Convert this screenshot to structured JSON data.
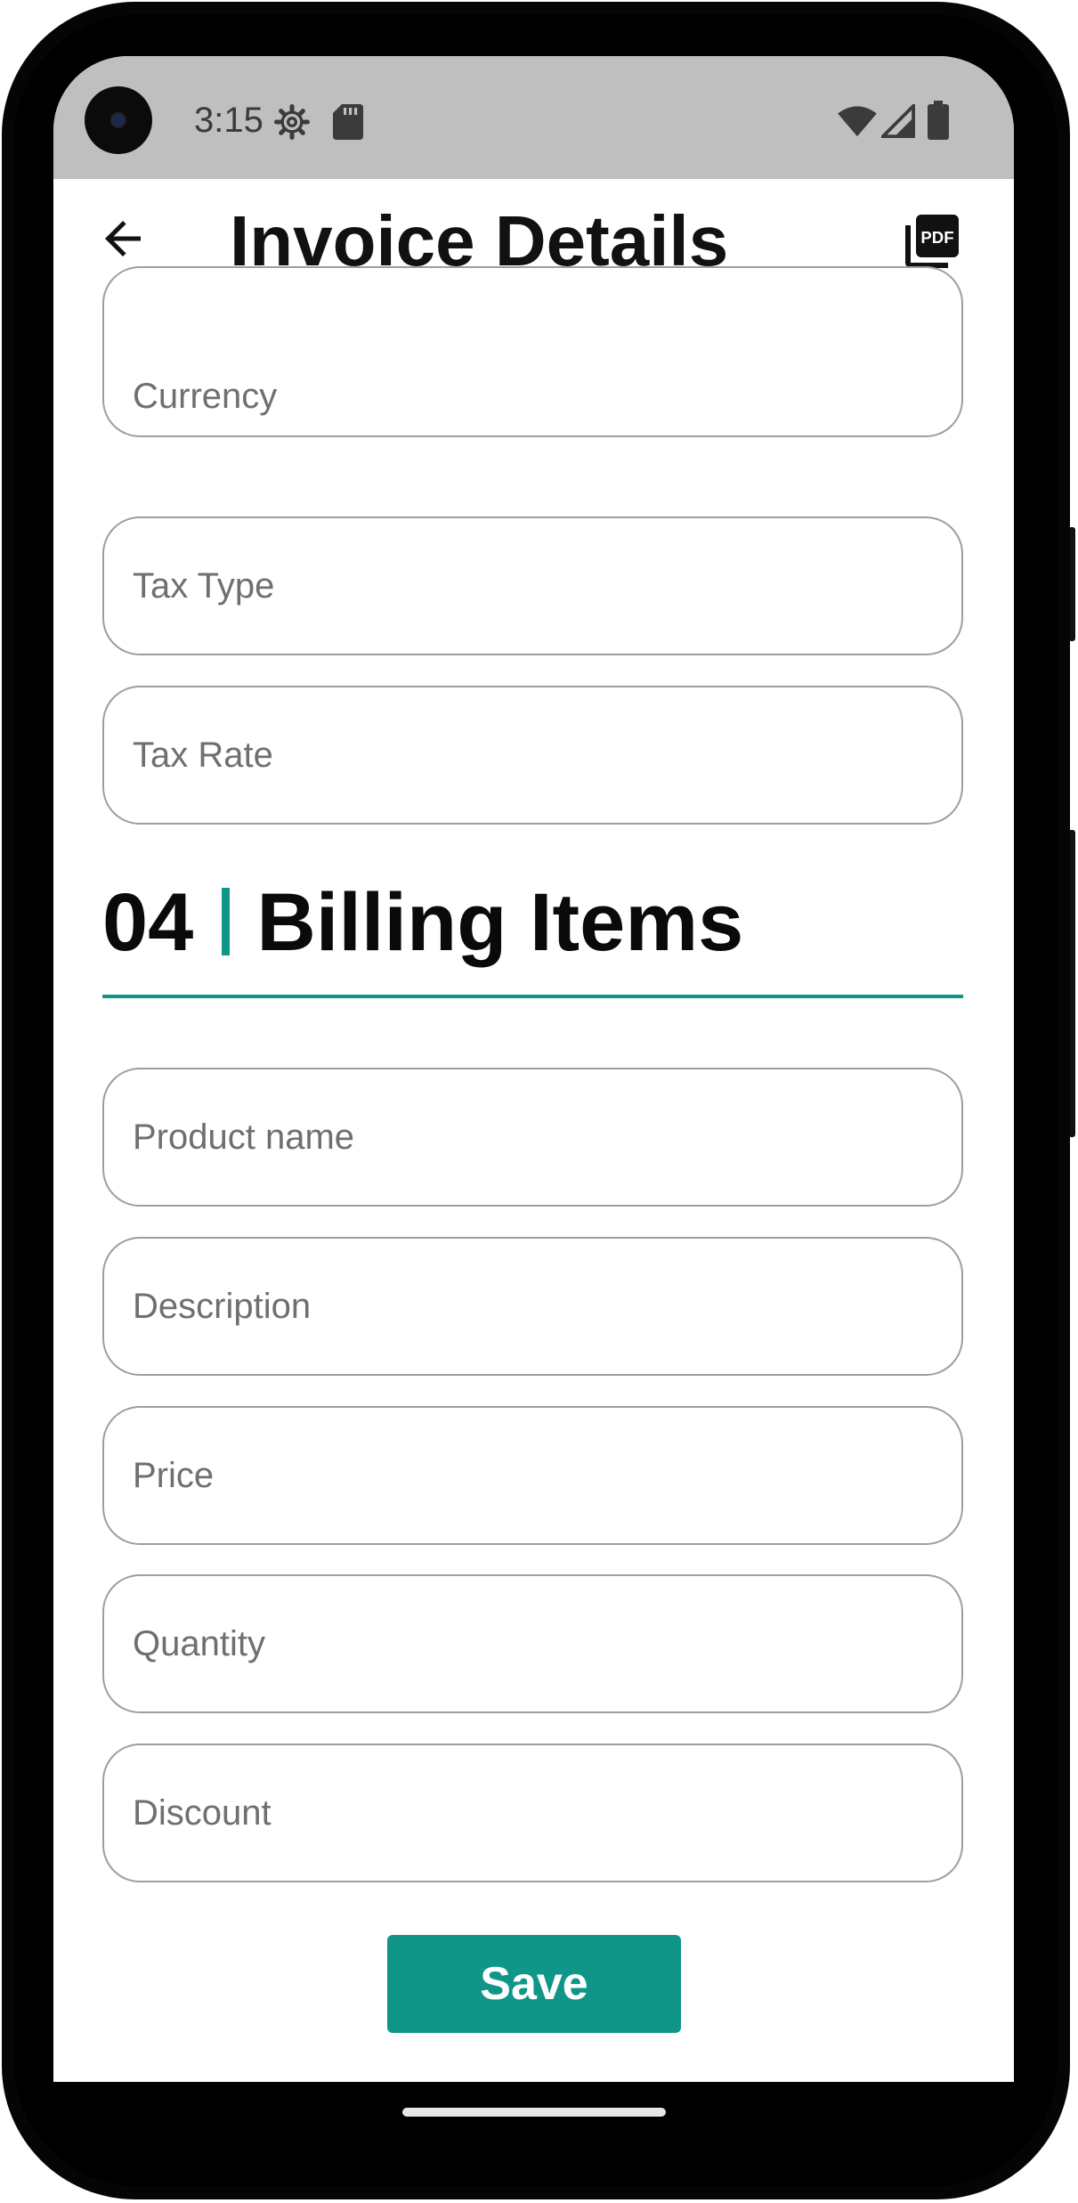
{
  "status_bar": {
    "time": "3:15",
    "icons": [
      "settings-icon",
      "sd-card-icon",
      "wifi-icon",
      "cell-signal-icon",
      "battery-icon"
    ]
  },
  "app_bar": {
    "title": "Invoice Details",
    "back_icon": "arrow-back-icon",
    "action_icon": "pdf-icon"
  },
  "tax_fields": [
    {
      "placeholder": "Currency",
      "value": ""
    },
    {
      "placeholder": "Tax Type",
      "value": ""
    },
    {
      "placeholder": "Tax Rate",
      "value": ""
    }
  ],
  "billing_section": {
    "number": "04",
    "title": "Billing Items"
  },
  "billing_fields": [
    {
      "placeholder": "Product name",
      "value": ""
    },
    {
      "placeholder": "Description",
      "value": ""
    },
    {
      "placeholder": "Price",
      "value": ""
    },
    {
      "placeholder": "Quantity",
      "value": ""
    },
    {
      "placeholder": "Discount",
      "value": ""
    }
  ],
  "actions": {
    "save_label": "Save"
  },
  "colors": {
    "accent": "#0f9688",
    "status_bar": "#bfbfbf",
    "field_border": "#9e9e9e",
    "placeholder": "#6f6f6f"
  }
}
